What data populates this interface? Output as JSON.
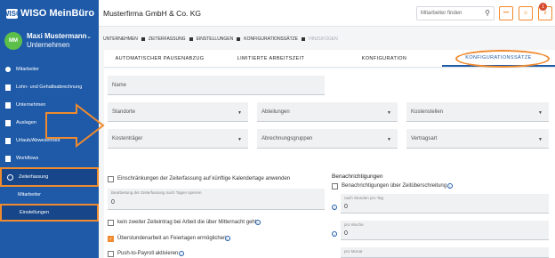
{
  "app": {
    "logo": "WISO MeinBüro",
    "logo_mark": "WISO"
  },
  "user": {
    "initials": "MM",
    "name": "Maxi Mustermann",
    "role": "Unternehmen"
  },
  "nav": [
    {
      "label": "Mitarbeiter"
    },
    {
      "label": "Lohn- und Gehaltsabrechnung"
    },
    {
      "label": "Unternehmen"
    },
    {
      "label": "Auslagen"
    },
    {
      "label": "Urlaub/Abwesenheit"
    },
    {
      "label": "Workflows"
    },
    {
      "label": "Zeiterfassung"
    }
  ],
  "subnav": [
    {
      "label": "Mitarbeiter"
    },
    {
      "label": "Einstellungen"
    }
  ],
  "topbar": {
    "company": "Musterfirma GmbH & Co. KG",
    "search_placeholder": "Mitarbeiter finden",
    "badge": "1"
  },
  "breadcrumb": [
    "UNTERNEHMEN",
    "ZEITERFASSUNG",
    "EINSTELLUNGEN",
    "KONFIGURATIONSSÄTZE",
    "HINZUFÜGEN"
  ],
  "tabs": [
    "AUTOMATISCHER PAUSENABZUG",
    "LIMITIERTE ARBEITSZEIT",
    "KONFIGURATION",
    "KONFIGURATIONSSÄTZE"
  ],
  "form": {
    "name_label": "Name",
    "selects": [
      "Standorte",
      "Abteilungen",
      "Kostenstellen",
      "Kostenträger",
      "Abrechnungsgruppen",
      "Vertragsart"
    ]
  },
  "options": {
    "restrict_label": "Einschränkungen der Zeiterfassung auf künftige Kalendertage anwenden",
    "days_label": "Bearbeitung der Zeiterfassung nach Tagen sperren",
    "days_value": "0",
    "second_entry": "kein zweiter Zeiteintrag bei Arbeit die über Mitternacht geht",
    "overtime_holidays": "Überstundenarbeit an Feiertagen ermöglichen",
    "push_payroll": "Push-to-Payroll aktivieren"
  },
  "notifications": {
    "heading": "Benachrichtigungen",
    "overtime_label": "Benachrichtigungen über Zeitüberschreitung",
    "per_day_label": "nach Stunden pro Tag",
    "per_day_value": "0",
    "per_week_label": "pro Woche",
    "per_week_value": "0",
    "per_month_label": "pro Monat"
  },
  "colors": {
    "primary": "#1e5aa8",
    "accent": "#f08a2e"
  }
}
